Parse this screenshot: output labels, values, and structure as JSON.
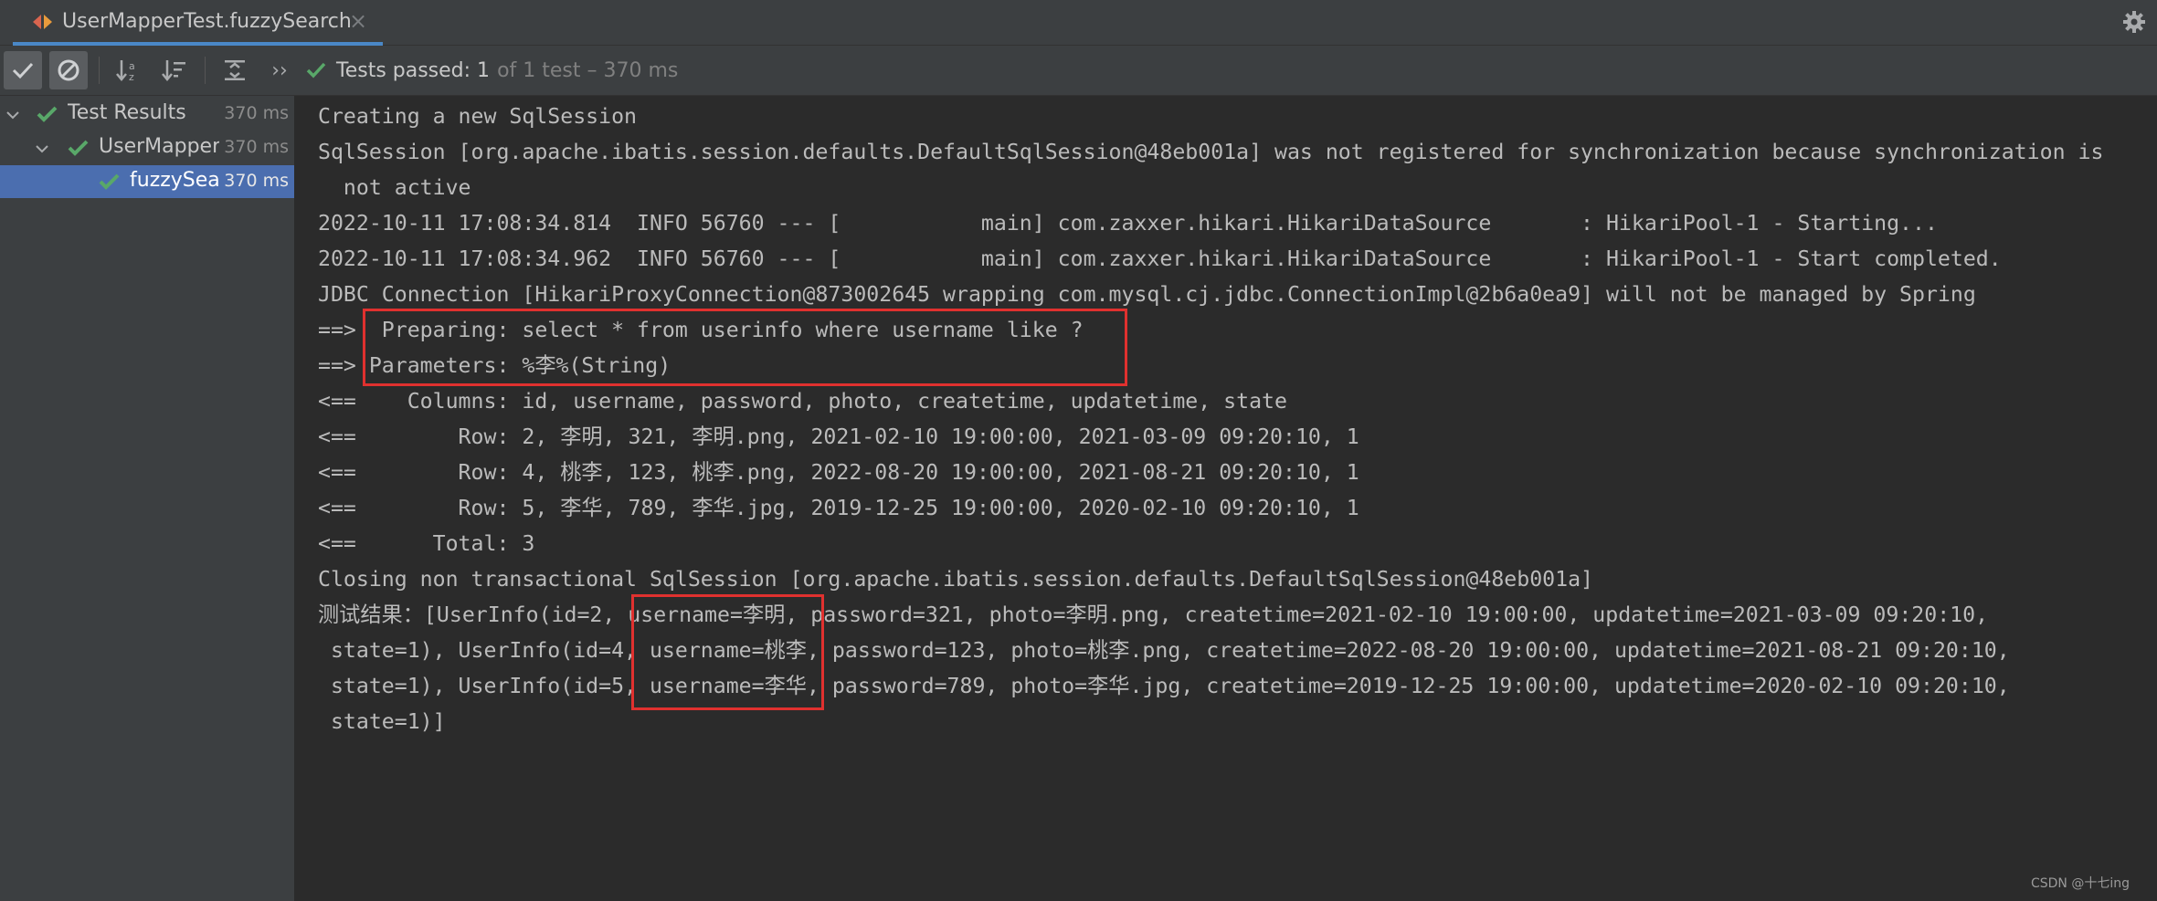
{
  "tab": {
    "title": "UserMapperTest.fuzzySearch",
    "close_glyph": "×"
  },
  "toolbar": {
    "status_main": "Tests passed: 1",
    "status_rest": "of 1 test – 370 ms",
    "buttons": [
      "show-passed",
      "show-ignored",
      "sort-alphabetically",
      "sort-by-duration",
      "expand-all",
      "more"
    ]
  },
  "tree": {
    "items": [
      {
        "label": "Test Results",
        "duration": "370 ms"
      },
      {
        "label": "UserMapperTest",
        "duration": "370 ms"
      },
      {
        "label": "fuzzySearch",
        "duration": "370 ms"
      }
    ]
  },
  "console": {
    "lines": [
      "Creating a new SqlSession",
      "SqlSession [org.apache.ibatis.session.defaults.DefaultSqlSession@48eb001a] was not registered for synchronization because synchronization is",
      "  not active",
      "2022-10-11 17:08:34.814  INFO 56760 --- [           main] com.zaxxer.hikari.HikariDataSource       : HikariPool-1 - Starting...",
      "2022-10-11 17:08:34.962  INFO 56760 --- [           main] com.zaxxer.hikari.HikariDataSource       : HikariPool-1 - Start completed.",
      "JDBC Connection [HikariProxyConnection@873002645 wrapping com.mysql.cj.jdbc.ConnectionImpl@2b6a0ea9] will not be managed by Spring",
      "==>  Preparing: select * from userinfo where username like ?",
      "==> Parameters: %李%(String)",
      "<==    Columns: id, username, password, photo, createtime, updatetime, state",
      "<==        Row: 2, 李明, 321, 李明.png, 2021-02-10 19:00:00, 2021-03-09 09:20:10, 1",
      "<==        Row: 4, 桃李, 123, 桃李.png, 2022-08-20 19:00:00, 2021-08-21 09:20:10, 1",
      "<==        Row: 5, 李华, 789, 李华.jpg, 2019-12-25 19:00:00, 2020-02-10 09:20:10, 1",
      "<==      Total: 3",
      "Closing non transactional SqlSession [org.apache.ibatis.session.defaults.DefaultSqlSession@48eb001a]",
      "测试结果：[UserInfo(id=2, username=李明, password=321, photo=李明.png, createtime=2021-02-10 19:00:00, updatetime=2021-03-09 09:20:10,",
      " state=1), UserInfo(id=4, username=桃李, password=123, photo=桃李.png, createtime=2022-08-20 19:00:00, updatetime=2021-08-21 09:20:10,",
      " state=1), UserInfo(id=5, username=李华, password=789, photo=李华.jpg, createtime=2019-12-25 19:00:00, updatetime=2020-02-10 09:20:10,",
      " state=1)]"
    ]
  },
  "watermark": "CSDN @十七ing",
  "colors": {
    "background": "#2b2b2b",
    "panel": "#3c3f41",
    "pass_green": "#59a869",
    "selection": "#4b6eaf",
    "highlight_box": "#e0312f",
    "tab_accent": "#4a88c7"
  }
}
